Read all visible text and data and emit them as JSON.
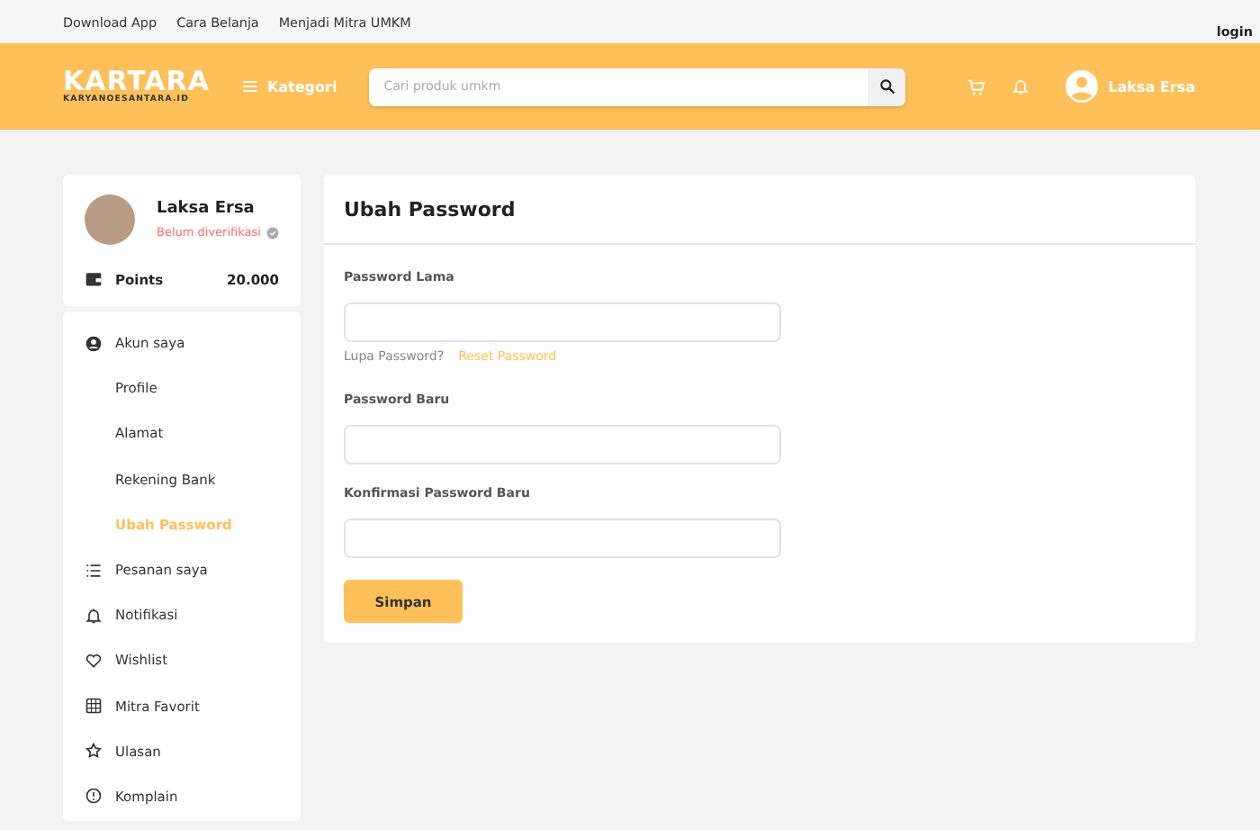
{
  "top_links": [
    "Download App",
    "Cara Belanja",
    "Menjadi Mitra UMKM"
  ],
  "login": "login",
  "header": {
    "logo": "KARTARA",
    "logo_sub": "KARYANOESANTARA.ID",
    "category": "Kategori",
    "search": {
      "placeholder": "Cari produk umkm"
    },
    "user": "Laksa Ersa"
  },
  "profile": {
    "name": "Laksa Ersa",
    "status": "Belum diverifikasi",
    "verified": false,
    "points_label": "Points",
    "points": "20.000"
  },
  "menu": [
    {
      "kind": "section",
      "label": "Akun saya",
      "selected": false
    },
    {
      "kind": "sub",
      "label": "Profile",
      "selected": false
    },
    {
      "kind": "sub",
      "label": "Alamat",
      "selected": false
    },
    {
      "kind": "sub",
      "label": "Rekening Bank",
      "selected": false
    },
    {
      "kind": "sub",
      "label": "Ubah Password",
      "selected": true
    },
    {
      "kind": "section",
      "label": "Pesanan saya",
      "selected": false
    },
    {
      "kind": "section",
      "label": "Notifikasi",
      "selected": false
    },
    {
      "kind": "section",
      "label": "Wishlist",
      "selected": false
    },
    {
      "kind": "section",
      "label": "Mitra Favorit",
      "selected": false
    },
    {
      "kind": "section",
      "label": "Ulasan",
      "selected": false
    },
    {
      "kind": "section",
      "label": "Komplain",
      "selected": false
    }
  ],
  "form": {
    "title": "Ubah Password",
    "fields": [
      {
        "label": "Password Lama",
        "hint": "Lupa Password?",
        "link": "Reset Password"
      },
      {
        "label": "Password Baru"
      },
      {
        "label": "Konfirmasi Password Baru"
      }
    ],
    "submit": "Simpan"
  }
}
